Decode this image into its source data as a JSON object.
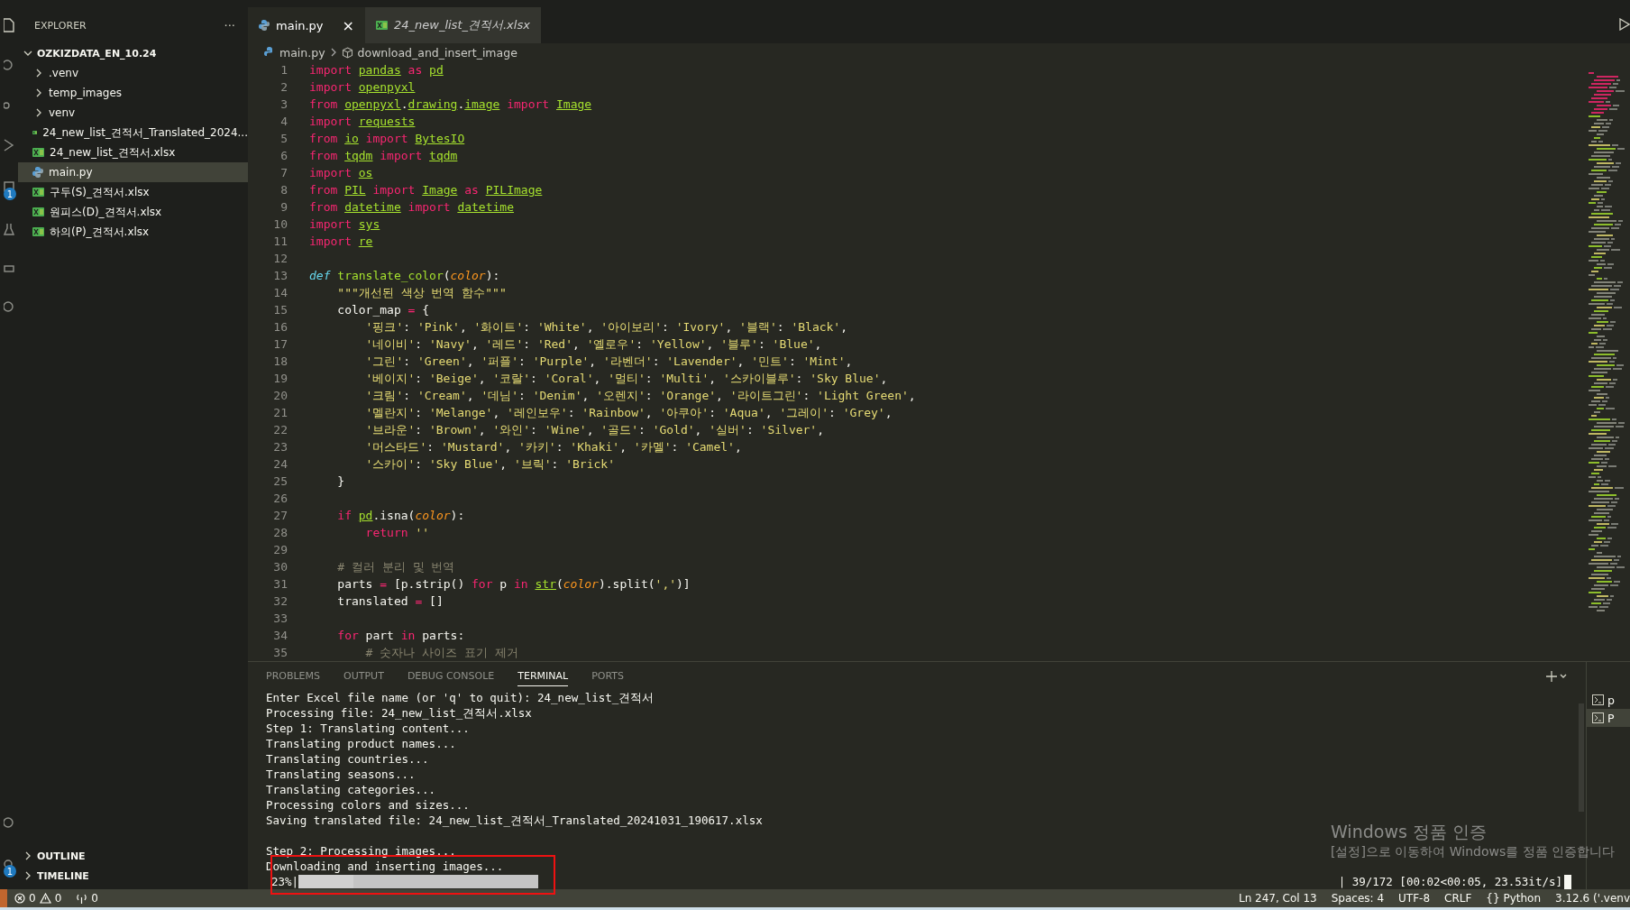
{
  "activity_bar": {
    "badges": [
      "1",
      "1"
    ]
  },
  "sidebar": {
    "title": "EXPLORER",
    "more": "···",
    "root": {
      "label": "OZKIZDATA_EN_10.24",
      "expanded": true,
      "children": [
        {
          "kind": "folder",
          "label": ".venv",
          "expanded": false,
          "selected": false
        },
        {
          "kind": "folder",
          "label": "temp_images",
          "expanded": false,
          "selected": false
        },
        {
          "kind": "folder",
          "label": "venv",
          "expanded": false,
          "selected": false
        },
        {
          "kind": "xlsx",
          "label": "24_new_list_견적서_Translated_2024...",
          "selected": false
        },
        {
          "kind": "xlsx",
          "label": "24_new_list_견적서.xlsx",
          "selected": false
        },
        {
          "kind": "py",
          "label": "main.py",
          "selected": true
        },
        {
          "kind": "xlsx",
          "label": "구두(S)_견적서.xlsx",
          "selected": false
        },
        {
          "kind": "xlsx",
          "label": "원피스(D)_견적서.xlsx",
          "selected": false
        },
        {
          "kind": "xlsx",
          "label": "하의(P)_견적서.xlsx",
          "selected": false
        }
      ]
    },
    "sections": [
      {
        "label": "OUTLINE",
        "expanded": false
      },
      {
        "label": "TIMELINE",
        "expanded": false
      }
    ]
  },
  "tabs": [
    {
      "kind": "py",
      "label": "main.py",
      "selected": true,
      "close": "×"
    },
    {
      "kind": "xlsx",
      "label": "24_new_list_견적서.xlsx",
      "selected": false
    }
  ],
  "breadcrumb": [
    "main.py",
    "download_and_insert_image"
  ],
  "code": [
    {
      "number": "1",
      "tokens": [
        {
          "kind": "kw",
          "text": "import "
        },
        {
          "kind": "mod",
          "text": "pandas"
        },
        {
          "kind": "kw",
          "text": " as "
        },
        {
          "kind": "mod",
          "text": "pd"
        }
      ]
    },
    {
      "number": "2",
      "tokens": [
        {
          "kind": "kw",
          "text": "import "
        },
        {
          "kind": "mod",
          "text": "openpyxl"
        }
      ]
    },
    {
      "number": "3",
      "tokens": [
        {
          "kind": "kw",
          "text": "from "
        },
        {
          "kind": "mod",
          "text": "openpyxl"
        },
        {
          "kind": "txt",
          "text": "."
        },
        {
          "kind": "mod",
          "text": "drawing"
        },
        {
          "kind": "txt",
          "text": "."
        },
        {
          "kind": "mod",
          "text": "image"
        },
        {
          "kind": "kw",
          "text": " import "
        },
        {
          "kind": "mod",
          "text": "Image"
        }
      ]
    },
    {
      "number": "4",
      "tokens": [
        {
          "kind": "kw",
          "text": "import "
        },
        {
          "kind": "mod",
          "text": "requests"
        }
      ]
    },
    {
      "number": "5",
      "tokens": [
        {
          "kind": "kw",
          "text": "from "
        },
        {
          "kind": "mod",
          "text": "io"
        },
        {
          "kind": "kw",
          "text": " import "
        },
        {
          "kind": "mod",
          "text": "BytesIO"
        }
      ]
    },
    {
      "number": "6",
      "tokens": [
        {
          "kind": "kw",
          "text": "from "
        },
        {
          "kind": "mod",
          "text": "tqdm"
        },
        {
          "kind": "kw",
          "text": " import "
        },
        {
          "kind": "mod",
          "text": "tqdm"
        }
      ]
    },
    {
      "number": "7",
      "tokens": [
        {
          "kind": "kw",
          "text": "import "
        },
        {
          "kind": "mod",
          "text": "os"
        }
      ]
    },
    {
      "number": "8",
      "tokens": [
        {
          "kind": "kw",
          "text": "from "
        },
        {
          "kind": "mod",
          "text": "PIL"
        },
        {
          "kind": "kw",
          "text": " import "
        },
        {
          "kind": "mod",
          "text": "Image"
        },
        {
          "kind": "kw",
          "text": " as "
        },
        {
          "kind": "mod",
          "text": "PILImage"
        }
      ]
    },
    {
      "number": "9",
      "tokens": [
        {
          "kind": "kw",
          "text": "from "
        },
        {
          "kind": "mod",
          "text": "datetime"
        },
        {
          "kind": "kw",
          "text": " import "
        },
        {
          "kind": "mod",
          "text": "datetime"
        }
      ]
    },
    {
      "number": "10",
      "tokens": [
        {
          "kind": "kw",
          "text": "import "
        },
        {
          "kind": "mod",
          "text": "sys"
        }
      ]
    },
    {
      "number": "11",
      "tokens": [
        {
          "kind": "kw",
          "text": "import "
        },
        {
          "kind": "mod",
          "text": "re"
        }
      ]
    },
    {
      "number": "12"
    },
    {
      "number": "13",
      "tokens": [
        {
          "kind": "def",
          "text": "def "
        },
        {
          "kind": "fn",
          "text": "translate_color"
        },
        {
          "kind": "txt",
          "text": "("
        },
        {
          "kind": "param",
          "text": "color"
        },
        {
          "kind": "txt",
          "text": "):"
        }
      ]
    },
    {
      "number": "14",
      "tokens": [
        {
          "kind": "str",
          "text": "    \"\"\"개선된 색상 번역 함수\"\"\""
        }
      ]
    },
    {
      "number": "15",
      "tokens": [
        {
          "kind": "txt",
          "text": "    color_map "
        },
        {
          "kind": "op",
          "text": "="
        },
        {
          "kind": "txt",
          "text": " {"
        }
      ]
    },
    {
      "number": "16",
      "tokens": [
        {
          "kind": "str",
          "text": "        '핑크'"
        },
        {
          "kind": "txt",
          "text": ": "
        },
        {
          "kind": "str",
          "text": "'Pink'"
        },
        {
          "kind": "txt",
          "text": ", "
        },
        {
          "kind": "str",
          "text": "'화이트'"
        },
        {
          "kind": "txt",
          "text": ": "
        },
        {
          "kind": "str",
          "text": "'White'"
        },
        {
          "kind": "txt",
          "text": ", "
        },
        {
          "kind": "str",
          "text": "'아이보리'"
        },
        {
          "kind": "txt",
          "text": ": "
        },
        {
          "kind": "str",
          "text": "'Ivory'"
        },
        {
          "kind": "txt",
          "text": ", "
        },
        {
          "kind": "str",
          "text": "'블랙'"
        },
        {
          "kind": "txt",
          "text": ": "
        },
        {
          "kind": "str",
          "text": "'Black'"
        },
        {
          "kind": "txt",
          "text": ","
        }
      ]
    },
    {
      "number": "17",
      "tokens": [
        {
          "kind": "str",
          "text": "        '네이비'"
        },
        {
          "kind": "txt",
          "text": ": "
        },
        {
          "kind": "str",
          "text": "'Navy'"
        },
        {
          "kind": "txt",
          "text": ", "
        },
        {
          "kind": "str",
          "text": "'레드'"
        },
        {
          "kind": "txt",
          "text": ": "
        },
        {
          "kind": "str",
          "text": "'Red'"
        },
        {
          "kind": "txt",
          "text": ", "
        },
        {
          "kind": "str",
          "text": "'옐로우'"
        },
        {
          "kind": "txt",
          "text": ": "
        },
        {
          "kind": "str",
          "text": "'Yellow'"
        },
        {
          "kind": "txt",
          "text": ", "
        },
        {
          "kind": "str",
          "text": "'블루'"
        },
        {
          "kind": "txt",
          "text": ": "
        },
        {
          "kind": "str",
          "text": "'Blue'"
        },
        {
          "kind": "txt",
          "text": ","
        }
      ]
    },
    {
      "number": "18",
      "tokens": [
        {
          "kind": "str",
          "text": "        '그린'"
        },
        {
          "kind": "txt",
          "text": ": "
        },
        {
          "kind": "str",
          "text": "'Green'"
        },
        {
          "kind": "txt",
          "text": ", "
        },
        {
          "kind": "str",
          "text": "'퍼플'"
        },
        {
          "kind": "txt",
          "text": ": "
        },
        {
          "kind": "str",
          "text": "'Purple'"
        },
        {
          "kind": "txt",
          "text": ", "
        },
        {
          "kind": "str",
          "text": "'라벤더'"
        },
        {
          "kind": "txt",
          "text": ": "
        },
        {
          "kind": "str",
          "text": "'Lavender'"
        },
        {
          "kind": "txt",
          "text": ", "
        },
        {
          "kind": "str",
          "text": "'민트'"
        },
        {
          "kind": "txt",
          "text": ": "
        },
        {
          "kind": "str",
          "text": "'Mint'"
        },
        {
          "kind": "txt",
          "text": ","
        }
      ]
    },
    {
      "number": "19",
      "tokens": [
        {
          "kind": "str",
          "text": "        '베이지'"
        },
        {
          "kind": "txt",
          "text": ": "
        },
        {
          "kind": "str",
          "text": "'Beige'"
        },
        {
          "kind": "txt",
          "text": ", "
        },
        {
          "kind": "str",
          "text": "'코랄'"
        },
        {
          "kind": "txt",
          "text": ": "
        },
        {
          "kind": "str",
          "text": "'Coral'"
        },
        {
          "kind": "txt",
          "text": ", "
        },
        {
          "kind": "str",
          "text": "'멀티'"
        },
        {
          "kind": "txt",
          "text": ": "
        },
        {
          "kind": "str",
          "text": "'Multi'"
        },
        {
          "kind": "txt",
          "text": ", "
        },
        {
          "kind": "str",
          "text": "'스카이블루'"
        },
        {
          "kind": "txt",
          "text": ": "
        },
        {
          "kind": "str",
          "text": "'Sky Blue'"
        },
        {
          "kind": "txt",
          "text": ","
        }
      ]
    },
    {
      "number": "20",
      "tokens": [
        {
          "kind": "str",
          "text": "        '크림'"
        },
        {
          "kind": "txt",
          "text": ": "
        },
        {
          "kind": "str",
          "text": "'Cream'"
        },
        {
          "kind": "txt",
          "text": ", "
        },
        {
          "kind": "str",
          "text": "'데님'"
        },
        {
          "kind": "txt",
          "text": ": "
        },
        {
          "kind": "str",
          "text": "'Denim'"
        },
        {
          "kind": "txt",
          "text": ", "
        },
        {
          "kind": "str",
          "text": "'오렌지'"
        },
        {
          "kind": "txt",
          "text": ": "
        },
        {
          "kind": "str",
          "text": "'Orange'"
        },
        {
          "kind": "txt",
          "text": ", "
        },
        {
          "kind": "str",
          "text": "'라이트그린'"
        },
        {
          "kind": "txt",
          "text": ": "
        },
        {
          "kind": "str",
          "text": "'Light Green'"
        },
        {
          "kind": "txt",
          "text": ","
        }
      ]
    },
    {
      "number": "21",
      "tokens": [
        {
          "kind": "str",
          "text": "        '멜란지'"
        },
        {
          "kind": "txt",
          "text": ": "
        },
        {
          "kind": "str",
          "text": "'Melange'"
        },
        {
          "kind": "txt",
          "text": ", "
        },
        {
          "kind": "str",
          "text": "'레인보우'"
        },
        {
          "kind": "txt",
          "text": ": "
        },
        {
          "kind": "str",
          "text": "'Rainbow'"
        },
        {
          "kind": "txt",
          "text": ", "
        },
        {
          "kind": "str",
          "text": "'아쿠아'"
        },
        {
          "kind": "txt",
          "text": ": "
        },
        {
          "kind": "str",
          "text": "'Aqua'"
        },
        {
          "kind": "txt",
          "text": ", "
        },
        {
          "kind": "str",
          "text": "'그레이'"
        },
        {
          "kind": "txt",
          "text": ": "
        },
        {
          "kind": "str",
          "text": "'Grey'"
        },
        {
          "kind": "txt",
          "text": ","
        }
      ]
    },
    {
      "number": "22",
      "tokens": [
        {
          "kind": "str",
          "text": "        '브라운'"
        },
        {
          "kind": "txt",
          "text": ": "
        },
        {
          "kind": "str",
          "text": "'Brown'"
        },
        {
          "kind": "txt",
          "text": ", "
        },
        {
          "kind": "str",
          "text": "'와인'"
        },
        {
          "kind": "txt",
          "text": ": "
        },
        {
          "kind": "str",
          "text": "'Wine'"
        },
        {
          "kind": "txt",
          "text": ", "
        },
        {
          "kind": "str",
          "text": "'골드'"
        },
        {
          "kind": "txt",
          "text": ": "
        },
        {
          "kind": "str",
          "text": "'Gold'"
        },
        {
          "kind": "txt",
          "text": ", "
        },
        {
          "kind": "str",
          "text": "'실버'"
        },
        {
          "kind": "txt",
          "text": ": "
        },
        {
          "kind": "str",
          "text": "'Silver'"
        },
        {
          "kind": "txt",
          "text": ","
        }
      ]
    },
    {
      "number": "23",
      "tokens": [
        {
          "kind": "str",
          "text": "        '머스타드'"
        },
        {
          "kind": "txt",
          "text": ": "
        },
        {
          "kind": "str",
          "text": "'Mustard'"
        },
        {
          "kind": "txt",
          "text": ", "
        },
        {
          "kind": "str",
          "text": "'카키'"
        },
        {
          "kind": "txt",
          "text": ": "
        },
        {
          "kind": "str",
          "text": "'Khaki'"
        },
        {
          "kind": "txt",
          "text": ", "
        },
        {
          "kind": "str",
          "text": "'카멜'"
        },
        {
          "kind": "txt",
          "text": ": "
        },
        {
          "kind": "str",
          "text": "'Camel'"
        },
        {
          "kind": "txt",
          "text": ","
        }
      ]
    },
    {
      "number": "24",
      "tokens": [
        {
          "kind": "str",
          "text": "        '스카이'"
        },
        {
          "kind": "txt",
          "text": ": "
        },
        {
          "kind": "str",
          "text": "'Sky Blue'"
        },
        {
          "kind": "txt",
          "text": ", "
        },
        {
          "kind": "str",
          "text": "'브릭'"
        },
        {
          "kind": "txt",
          "text": ": "
        },
        {
          "kind": "str",
          "text": "'Brick'"
        }
      ]
    },
    {
      "number": "25",
      "tokens": [
        {
          "kind": "txt",
          "text": "    }"
        }
      ]
    },
    {
      "number": "26"
    },
    {
      "number": "27",
      "tokens": [
        {
          "kind": "kw",
          "text": "    if "
        },
        {
          "kind": "mod",
          "text": "pd"
        },
        {
          "kind": "txt",
          "text": ".isna("
        },
        {
          "kind": "param",
          "text": "color"
        },
        {
          "kind": "txt",
          "text": "):"
        }
      ]
    },
    {
      "number": "28",
      "tokens": [
        {
          "kind": "kw",
          "text": "        return "
        },
        {
          "kind": "str",
          "text": "''"
        }
      ]
    },
    {
      "number": "29"
    },
    {
      "number": "30",
      "tokens": [
        {
          "kind": "cmt",
          "text": "    # 컬러 분리 및 번역"
        }
      ]
    },
    {
      "number": "31",
      "tokens": [
        {
          "kind": "txt",
          "text": "    parts "
        },
        {
          "kind": "op",
          "text": "="
        },
        {
          "kind": "txt",
          "text": " [p.strip() "
        },
        {
          "kind": "kw",
          "text": "for"
        },
        {
          "kind": "txt",
          "text": " p "
        },
        {
          "kind": "kw",
          "text": "in "
        },
        {
          "kind": "mod",
          "text": "str"
        },
        {
          "kind": "txt",
          "text": "("
        },
        {
          "kind": "param",
          "text": "color"
        },
        {
          "kind": "txt",
          "text": ").split("
        },
        {
          "kind": "str",
          "text": "','"
        },
        {
          "kind": "txt",
          "text": ")]"
        }
      ]
    },
    {
      "number": "32",
      "tokens": [
        {
          "kind": "txt",
          "text": "    translated "
        },
        {
          "kind": "op",
          "text": "="
        },
        {
          "kind": "txt",
          "text": " []"
        }
      ]
    },
    {
      "number": "33"
    },
    {
      "number": "34",
      "tokens": [
        {
          "kind": "kw",
          "text": "    for"
        },
        {
          "kind": "txt",
          "text": " part "
        },
        {
          "kind": "kw",
          "text": "in"
        },
        {
          "kind": "txt",
          "text": " parts:"
        }
      ]
    },
    {
      "number": "35",
      "tokens": [
        {
          "kind": "cmt",
          "text": "        # 숫자나 사이즈 표기 제거"
        }
      ]
    }
  ],
  "panel": {
    "tabs": [
      {
        "label": "PROBLEMS",
        "selected": false
      },
      {
        "label": "OUTPUT",
        "selected": false
      },
      {
        "label": "DEBUG CONSOLE",
        "selected": false
      },
      {
        "label": "TERMINAL",
        "selected": true
      },
      {
        "label": "PORTS",
        "selected": false
      }
    ],
    "terminal": {
      "lines": [
        {
          "kind": "text",
          "text": "Enter Excel file name (or 'q' to quit): 24_new_list_견적서"
        },
        {
          "kind": "text",
          "text": "Processing file: 24_new_list_견적서.xlsx"
        },
        {
          "kind": "text",
          "text": "Step 1: Translating content..."
        },
        {
          "kind": "text",
          "text": "Translating product names..."
        },
        {
          "kind": "text",
          "text": "Translating countries..."
        },
        {
          "kind": "text",
          "text": "Translating seasons..."
        },
        {
          "kind": "text",
          "text": "Translating categories..."
        },
        {
          "kind": "text",
          "text": "Processing colors and sizes..."
        },
        {
          "kind": "text",
          "text": "Saving translated file: 24_new_list_견적서_Translated_20241031_190617.xlsx"
        },
        {
          "kind": "blank"
        },
        {
          "kind": "text",
          "text": "Step 2: Processing images..."
        },
        {
          "kind": "text",
          "text": "Downloading and inserting images..."
        }
      ],
      "progress": {
        "percent": "23%|",
        "level": 0.23,
        "stats": "| 39/172 [00:02<00:05, 23.53it/s]"
      }
    },
    "terminal_list": [
      {
        "label": "p",
        "selected": false
      },
      {
        "label": "P",
        "selected": true
      }
    ]
  },
  "activation_notice": {
    "title": "Windows 정품 인증",
    "message": "[설정]으로 이동하여 Windows를 정품 인증합니다"
  },
  "status_bar": {
    "errors": "0",
    "warnings": "0",
    "ports": "0",
    "right": [
      "Ln 247, Col 13",
      "Spaces: 4",
      "UTF-8",
      "CRLF"
    ],
    "language_icon": "{}",
    "language": "Python",
    "interpreter": "3.12.6 ('.venv"
  }
}
